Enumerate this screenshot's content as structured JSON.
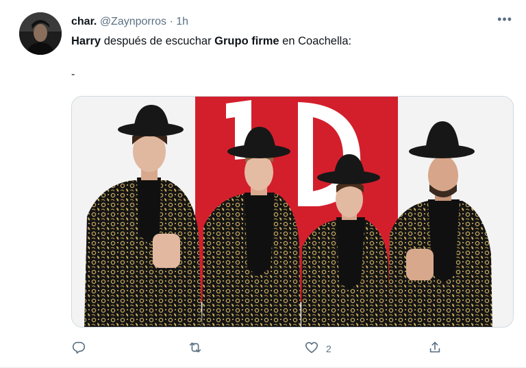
{
  "tweet": {
    "display_name": "char.",
    "handle": "@Zaynporros",
    "separator": "·",
    "time": "1h",
    "more": "•••",
    "text": {
      "part1": "Harry",
      "part2": " después de escuchar ",
      "part3": "Grupo firme",
      "part4": " en Coachella:"
    },
    "dash": "-",
    "likes": "2"
  },
  "icons": {
    "reply": "reply-icon",
    "retweet": "retweet-icon",
    "like": "heart-icon",
    "share": "share-icon",
    "more": "more-icon"
  },
  "colors": {
    "text": "#0f1419",
    "secondary": "#5b7083",
    "backdrop_red": "#d31f2c",
    "suit_black": "#161616",
    "suit_gold": "#c9a95c"
  }
}
